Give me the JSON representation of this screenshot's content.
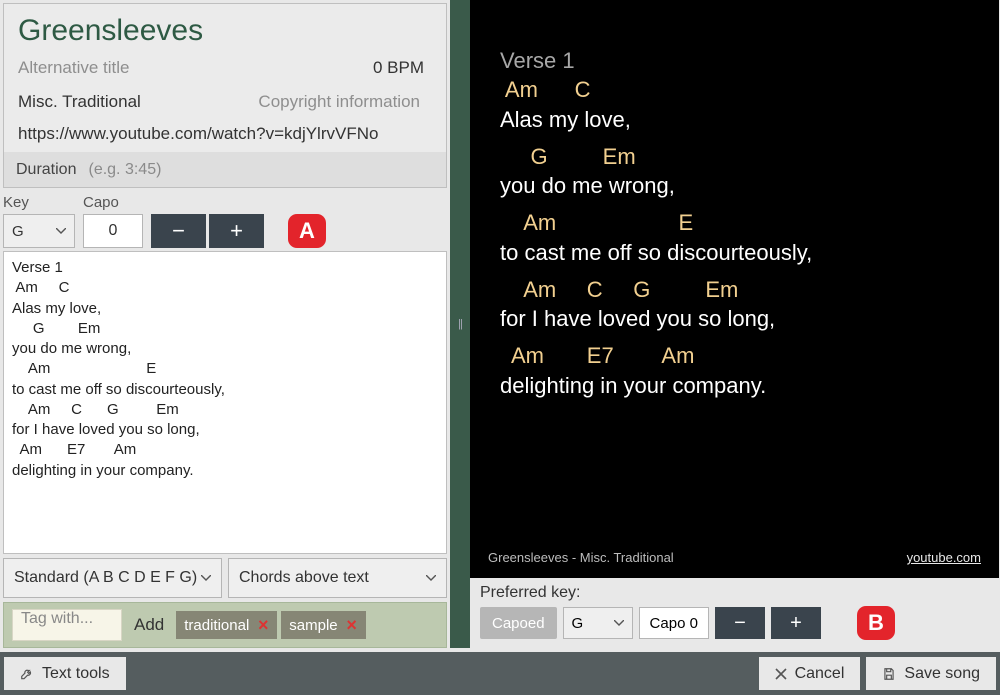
{
  "header": {
    "title": "Greensleeves",
    "alt_title_placeholder": "Alternative title",
    "bpm": "0 BPM",
    "artist": "Misc. Traditional",
    "copyright_placeholder": "Copyright information",
    "link": "https://www.youtube.com/watch?v=kdjYlrvVFNo",
    "duration_label": "Duration",
    "duration_placeholder": "(e.g. 3:45)"
  },
  "keycapo": {
    "key_label": "Key",
    "capo_label": "Capo",
    "key_value": "G",
    "capo_value": "0",
    "minus": "−",
    "plus": "+"
  },
  "badge_a": "A",
  "song_text": "Verse 1\n Am     C\nAlas my love,\n     G        Em\nyou do me wrong,\n    Am                       E\nto cast me off so discourteously,\n    Am     C      G         Em\nfor I have loved you so long,\n  Am      E7       Am\ndelighting in your company.",
  "format_select": "Standard (A B C D E F G)",
  "layout_select": "Chords above text",
  "tags": {
    "placeholder": "Tag with...",
    "add_label": "Add",
    "items": [
      "traditional",
      "sample"
    ]
  },
  "preview": {
    "section": "Verse 1",
    "lines": [
      {
        "chords": " Am      C",
        "lyrics": "Alas my love,"
      },
      {
        "chords": "     G         Em",
        "lyrics": "you do me wrong,"
      },
      {
        "chords": "    Am                    E",
        "lyrics": "to cast me off so discourteously,"
      },
      {
        "chords": "    Am     C     G         Em",
        "lyrics": "for I have loved you so long,"
      },
      {
        "chords": "  Am       E7        Am",
        "lyrics": "delighting in your company."
      }
    ],
    "footer_left": "Greensleeves -  Misc. Traditional",
    "footer_right": "youtube.com"
  },
  "pref": {
    "label": "Preferred key:",
    "pill": "Capoed",
    "key": "G",
    "capo_display": "Capo 0",
    "badge": "B"
  },
  "bottom": {
    "text_tools": "Text tools",
    "cancel": "Cancel",
    "save": "Save song"
  }
}
